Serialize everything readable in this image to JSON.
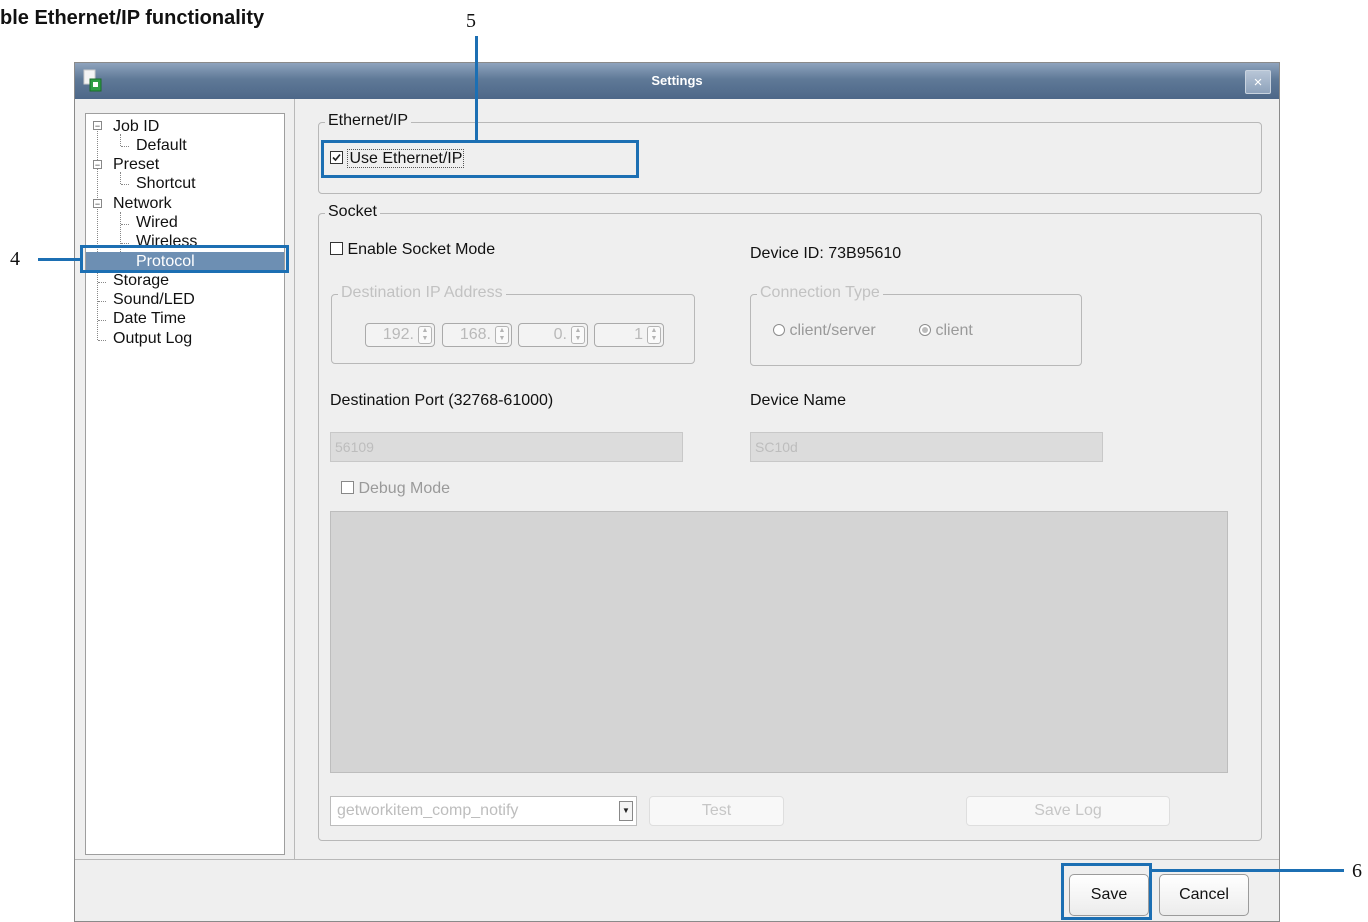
{
  "doc": {
    "heading": "ble Ethernet/IP functionality",
    "callouts": [
      "4",
      "5",
      "6"
    ]
  },
  "colors": {
    "highlight": "#1c6fb3",
    "titlebar": "#5f7997",
    "tree_selection": "#6d8fb3"
  },
  "window": {
    "title": "Settings",
    "close_glyph": "×"
  },
  "tree": {
    "items": [
      {
        "label": "Job ID",
        "level": 0,
        "expanded": true
      },
      {
        "label": "Default",
        "level": 1
      },
      {
        "label": "Preset",
        "level": 0,
        "expanded": true
      },
      {
        "label": "Shortcut",
        "level": 1
      },
      {
        "label": "Network",
        "level": 0,
        "expanded": true
      },
      {
        "label": "Wired",
        "level": 1
      },
      {
        "label": "Wireless",
        "level": 1
      },
      {
        "label": "Protocol",
        "level": 1,
        "selected": true
      },
      {
        "label": "Storage",
        "level": 0
      },
      {
        "label": "Sound/LED",
        "level": 0
      },
      {
        "label": "Date Time",
        "level": 0
      },
      {
        "label": "Output Log",
        "level": 0
      }
    ]
  },
  "ethernet": {
    "legend": "Ethernet/IP",
    "use_label": "Use Ethernet/IP",
    "use_checked": true
  },
  "socket": {
    "legend": "Socket",
    "enable_label": "Enable Socket Mode",
    "enable_checked": false,
    "device_id": "Device ID: 73B95610",
    "dest_ip": {
      "legend": "Destination IP Address",
      "octets": [
        "192.",
        "168.",
        "0.",
        "1"
      ]
    },
    "conn_type": {
      "legend": "Connection Type",
      "options": [
        "client/server",
        "client"
      ],
      "selected": "client"
    },
    "dest_port_label": "Destination Port (32768-61000)",
    "dest_port_value": "56109",
    "device_name_label": "Device Name",
    "device_name_value": "SC10d",
    "debug_label": "Debug Mode",
    "debug_checked": false,
    "command_select": "getworkitem_comp_notify",
    "test_label": "Test",
    "save_log_label": "Save Log"
  },
  "footer": {
    "save_label": "Save",
    "cancel_label": "Cancel"
  }
}
